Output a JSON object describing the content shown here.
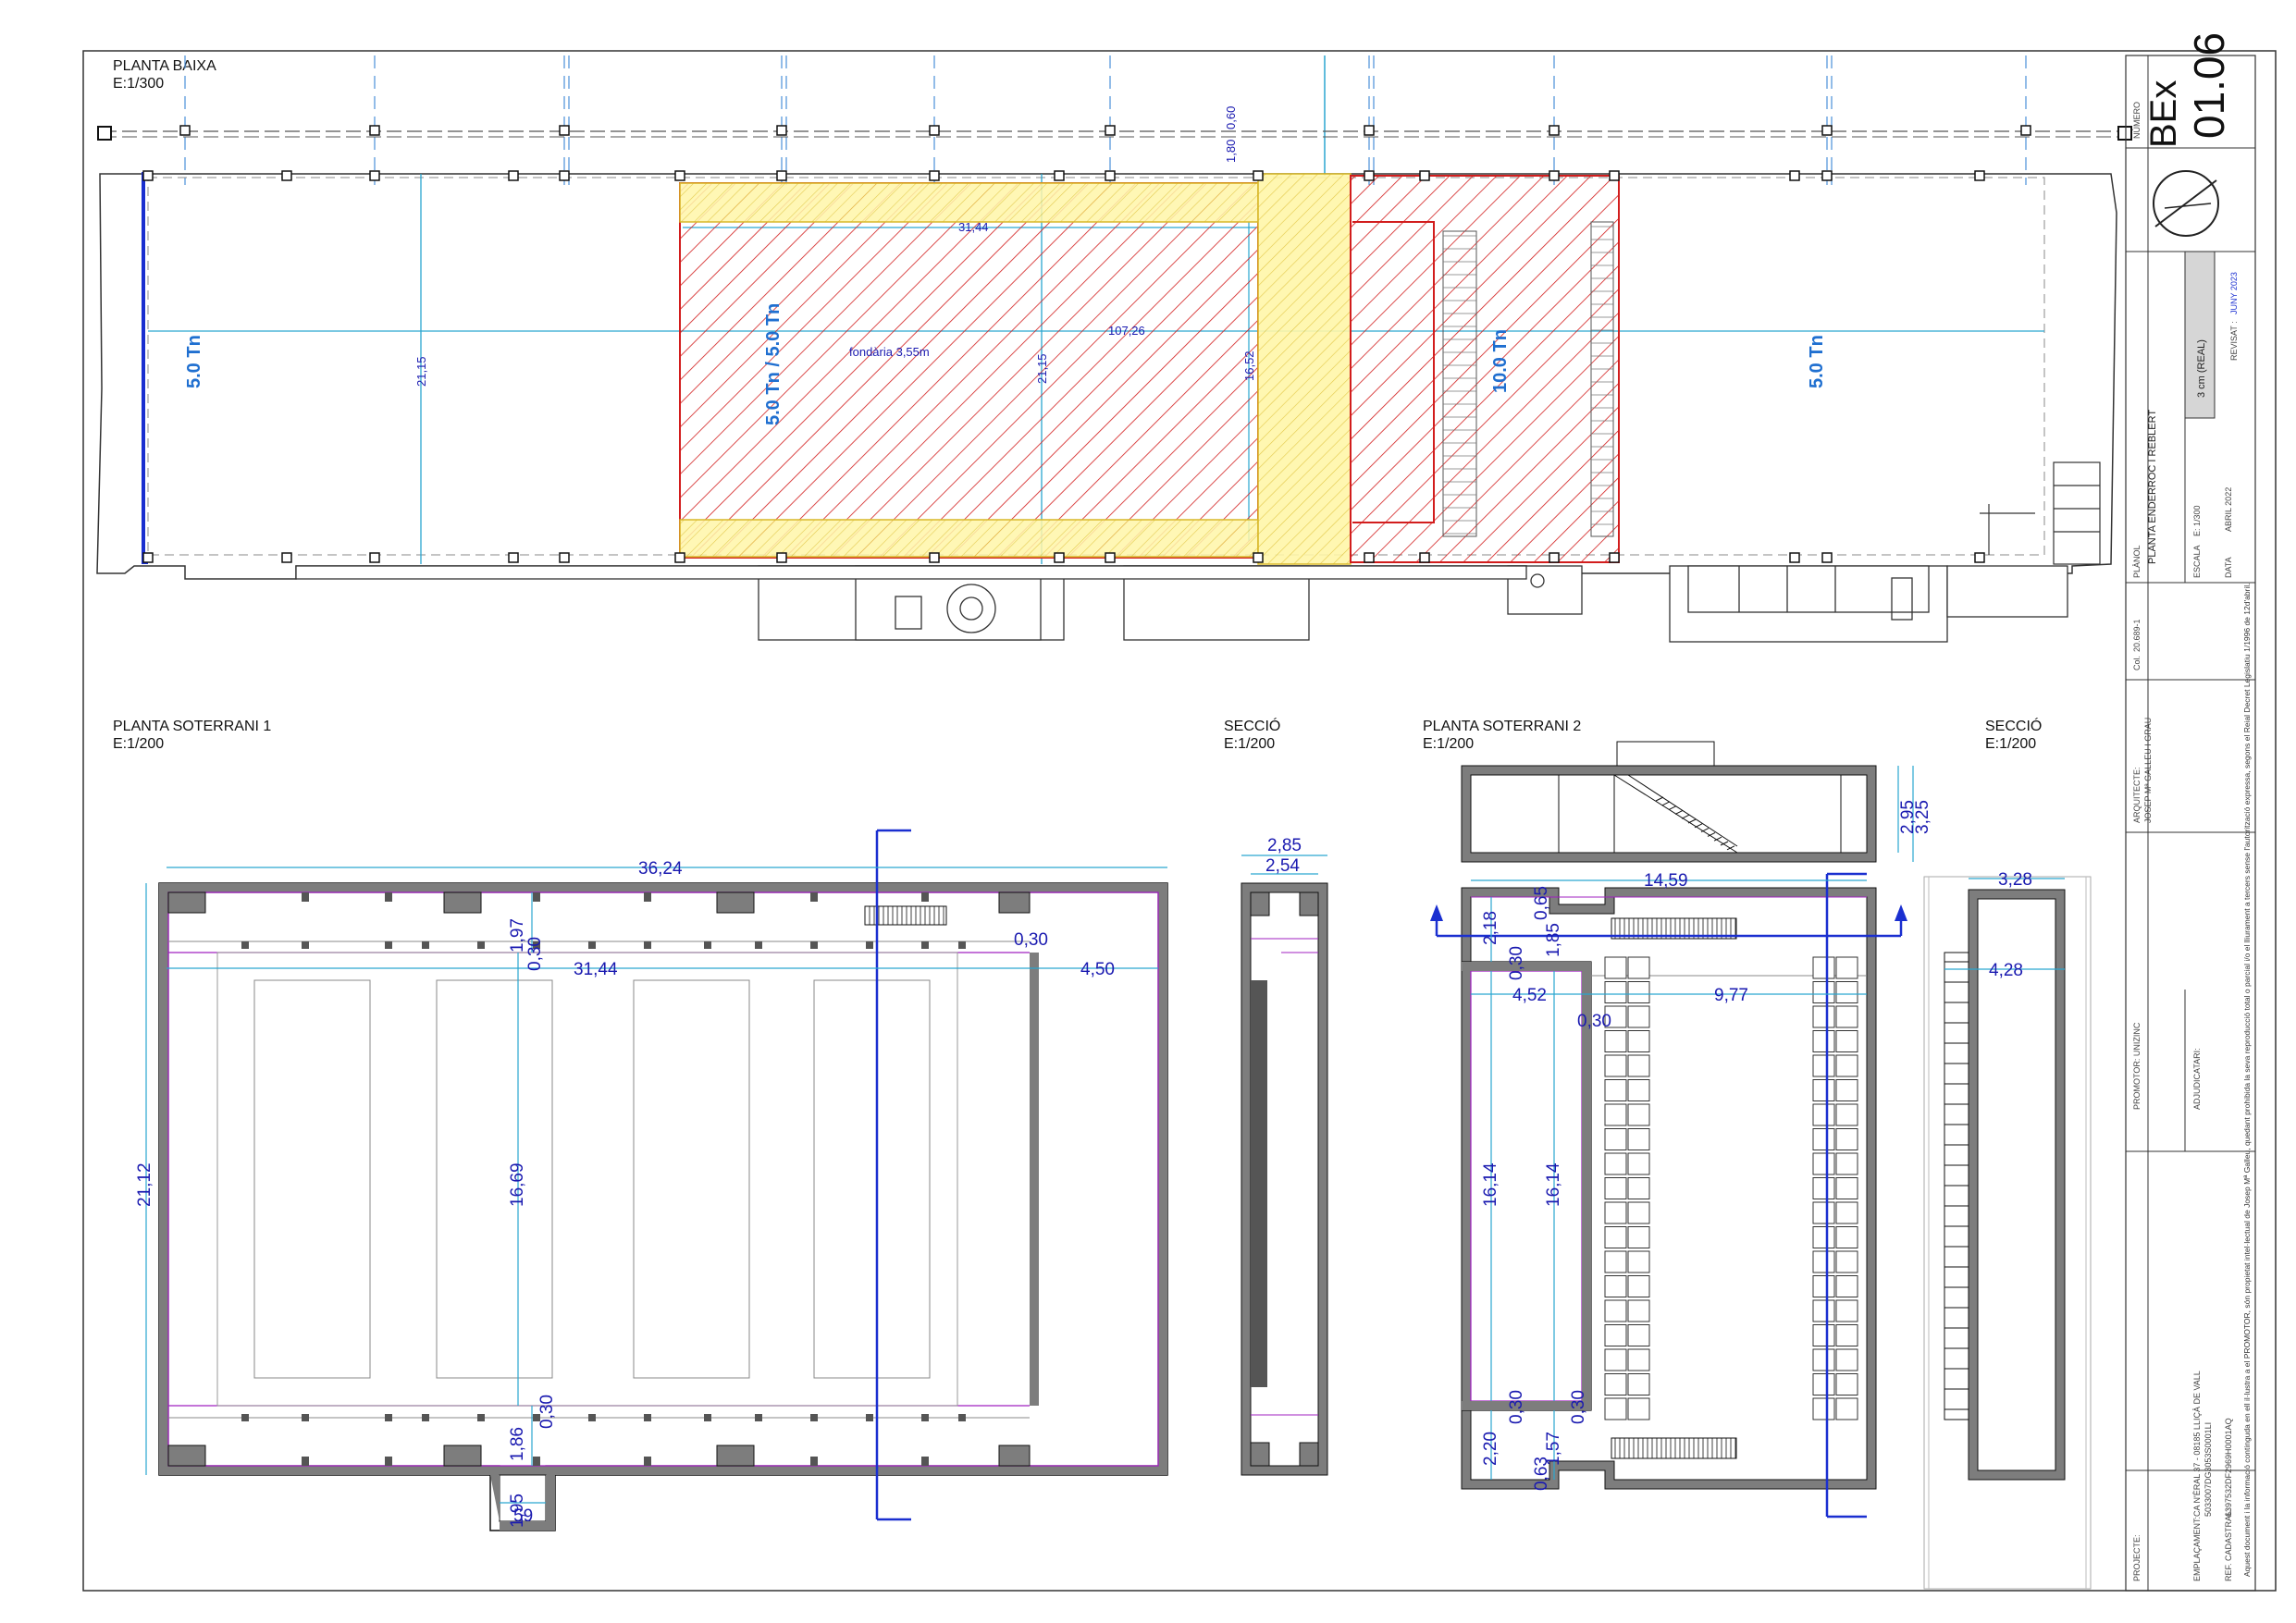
{
  "planta_baixa": {
    "title": "PLANTA BAIXA",
    "scale": "E:1/300",
    "loads": [
      "5.0 Tn",
      "5.0 Tn / 5.0 Tn",
      "10.0 Tn",
      "5.0 Tn"
    ],
    "dims": {
      "length_total": "107,26",
      "length_hatched": "31,44",
      "width_left": "21,15",
      "width_mid": "21,15",
      "width_inner": "16,52",
      "top_offset": "1,80",
      "top_offset2": "0,60",
      "depth_note": "fondària 3,55m"
    }
  },
  "soterrani1": {
    "title": "PLANTA SOTERRANI 1",
    "scale": "E:1/200",
    "dims": {
      "width_total": "36,24",
      "width_inner": "31,44",
      "right_gap": "4,50",
      "height_total": "21,12",
      "height_inner": "16,69",
      "wall_1": "0,30",
      "top_band": "1,97",
      "wall_2": "0,30",
      "bottom_band": "1,86",
      "wall_3": "0,30",
      "wall_4": "0,30",
      "stub_w": "1,95",
      "stub_h": "59"
    }
  },
  "seccio1": {
    "title": "SECCIÓ",
    "scale": "E:1/200",
    "dims": {
      "outer": "2,85",
      "inner": "2,54"
    }
  },
  "soterrani2": {
    "title": "PLANTA SOTERRANI 2",
    "scale": "E:1/200",
    "dims": {
      "width_top": "14,59",
      "top_left_h": "2,18",
      "top_notch": "0,65",
      "top_mid": "1,85",
      "left_w": "4,52",
      "right_w": "9,77",
      "wall_a": "0,30",
      "wall_b": "0,30",
      "height_left": "16,14",
      "height_mid": "16,14",
      "bottom_left": "2,20",
      "wall_c": "0,30",
      "wall_d": "0,30",
      "bottom_notch": "0,63",
      "bottom_mid": "1,57"
    }
  },
  "seccio2": {
    "title": "SECCIÓ",
    "scale": "E:1/200",
    "dims": {
      "top": "3,28",
      "inner": "4,28"
    }
  },
  "section_small": {
    "h1": "2,95",
    "h2": "3,25"
  },
  "title_block": {
    "numero_label": "NÚMERO",
    "code": "BEx",
    "number": "01.06",
    "scale_box": "3 cm (REAL)",
    "revisat_label": "REVISAT :",
    "revisat_value": "JUNY 2023",
    "planol_label": "PLÀNOL",
    "planol_value": "PLANTA ENDERROC I REBLERT",
    "escala_label": "ESCALA",
    "escala_value": "E: 1/300",
    "data_label": "DATA",
    "data_value": "ABRIL 2022",
    "col_label": "Col.",
    "col_value": "20.689-1",
    "arquitecte_label": "ARQUITECTE:",
    "arquitecte_value": "JOSEP Mª GALLEU I GRAU",
    "promotor_label": "PROMOTOR: UNIZINC",
    "adjudicatari_label": "ADJUDICATARI:",
    "projecte_label": "PROJECTE:",
    "emplacament_label": "EMPLAÇAMENT:",
    "emplacament_value": "CA N'ÈRAL 37 - 08185 LLIÇÀ DE VALL",
    "emplacament_value2": "5033007DG3053S0001LI",
    "ref_label": "REF. CADASTRAL:",
    "ref_value": "6397532DF2969H0001AQ",
    "legal": "Aquest document i la informació continguda en ell il·lustra a el PROMOTOR, són propietat intel·lectual de Josep Mª Galleu, quedant prohibida la seva reproducció total o parcial i/o el lliurament a tercers sense l'autorització expressa, segons el Reial Decret Legislatiu 1/1996 de 12d'abril."
  }
}
